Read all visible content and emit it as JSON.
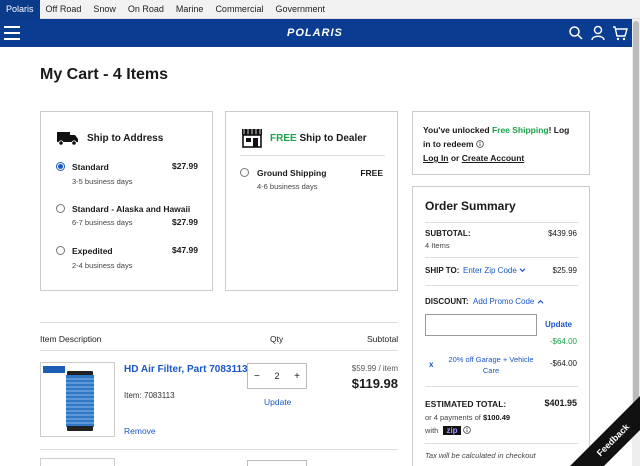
{
  "brand_tabs": [
    "Polaris",
    "Off Road",
    "Snow",
    "On Road",
    "Marine",
    "Commercial",
    "Government"
  ],
  "nav": {
    "logo": "POLARIS"
  },
  "page": {
    "title": "My Cart - 4 Items"
  },
  "ship_address": {
    "title": "Ship to Address",
    "options": [
      {
        "name": "Standard",
        "sub": "3-5 business days",
        "price": "$27.99",
        "selected": true
      },
      {
        "name": "Standard - Alaska and Hawaii",
        "sub": "6-7 business days",
        "price": "$27.99",
        "selected": false
      },
      {
        "name": "Expedited",
        "sub": "2-4 business days",
        "price": "$47.99",
        "selected": false
      }
    ]
  },
  "ship_dealer": {
    "title_free": "FREE",
    "title_rest": " Ship to Dealer",
    "option": {
      "name": "Ground Shipping",
      "sub": "4-6 business days",
      "price": "FREE"
    }
  },
  "table": {
    "col_description": "Item Description",
    "col_qty": "Qty",
    "col_subtotal": "Subtotal",
    "item": {
      "name": "HD Air Filter, Part 7083113",
      "number_label": "Item: 7083113",
      "qty": "2",
      "update_label": "Update",
      "unit_price": "$59.99 / item",
      "subtotal": "$119.98",
      "remove_label": "Remove",
      "decrement": "−",
      "increment": "+"
    }
  },
  "loyalty": {
    "prefix": "You've unlocked ",
    "highlight": "Free Shipping",
    "suffix": "! Log in to redeem",
    "login": "Log In",
    "or": " or ",
    "create": "Create Account"
  },
  "summary": {
    "title": "Order Summary",
    "subtotal_label": "SUBTOTAL:",
    "subtotal_val": "$439.96",
    "items_count": "4 Items",
    "shipto_label": "SHIP TO:",
    "zip_link": "Enter Zip Code",
    "ship_val": "$25.99",
    "discount_label": "DISCOUNT:",
    "promo_link": "Add Promo Code",
    "update_label": "Update",
    "discount_green": "-$64.00",
    "promo_desc": "20% off Garage + Vehicle Care",
    "promo_val": "-$64.00",
    "remove_x": "x",
    "estimated_label": "ESTIMATED TOTAL:",
    "estimated_val": "$401.95",
    "payments_prefix": "or 4 payments of ",
    "payments_amount": "$100.49",
    "with": "with",
    "zip_brand": "zip",
    "tax_note": "Tax will be calculated in checkout"
  },
  "feedback": "Feedback",
  "colors": {
    "nav_blue": "#0a3d91",
    "link_blue": "#1a57c7",
    "green": "#1aa34a"
  }
}
